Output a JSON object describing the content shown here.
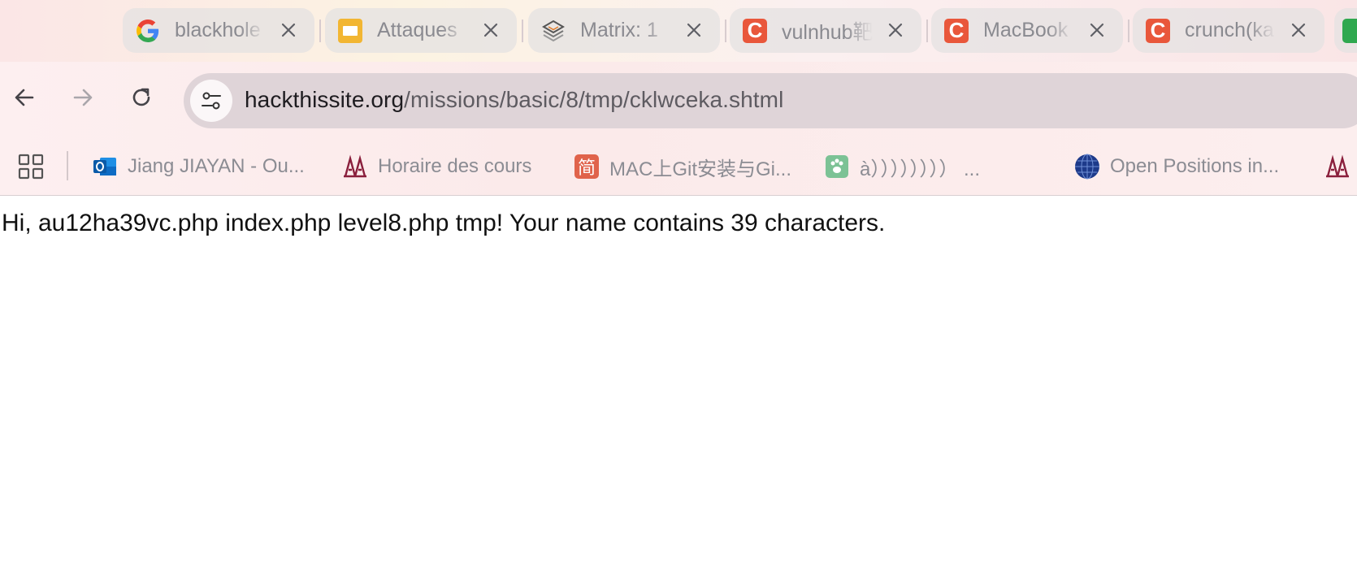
{
  "tabs": [
    {
      "title": "blackhole",
      "favicon": "google-icon"
    },
    {
      "title": "Attaques",
      "favicon": "slides-icon"
    },
    {
      "title": "Matrix: 1",
      "favicon": "matrix-icon"
    },
    {
      "title": "vulnhub靶",
      "favicon": "c-icon"
    },
    {
      "title": "MacBook",
      "favicon": "c-icon"
    },
    {
      "title": "crunch(ka",
      "favicon": "c-icon"
    }
  ],
  "toolbar": {
    "url_domain": "hackthissite.org",
    "url_path": "/missions/basic/8/tmp/cklwceka.shtml"
  },
  "bookmarks": [
    {
      "label": "Jiang JIAYAN - Ou...",
      "icon": "outlook-icon"
    },
    {
      "label": "Horaire des cours",
      "icon": "university-icon"
    },
    {
      "label": "MAC上Git安装与Gi...",
      "icon": "jianshu-icon",
      "glyph": "简"
    },
    {
      "label": "à）））））））） ...",
      "icon": "paw-icon"
    },
    {
      "label": "Open Positions in...",
      "icon": "globe-icon"
    }
  ],
  "page": {
    "message": "Hi, au12ha39vc.php index.php level8.php tmp! Your name contains 39 characters."
  },
  "colors": {
    "accent_c": "#e9573b",
    "slides": "#f2b632",
    "omnibox": "#dfd4d8"
  }
}
